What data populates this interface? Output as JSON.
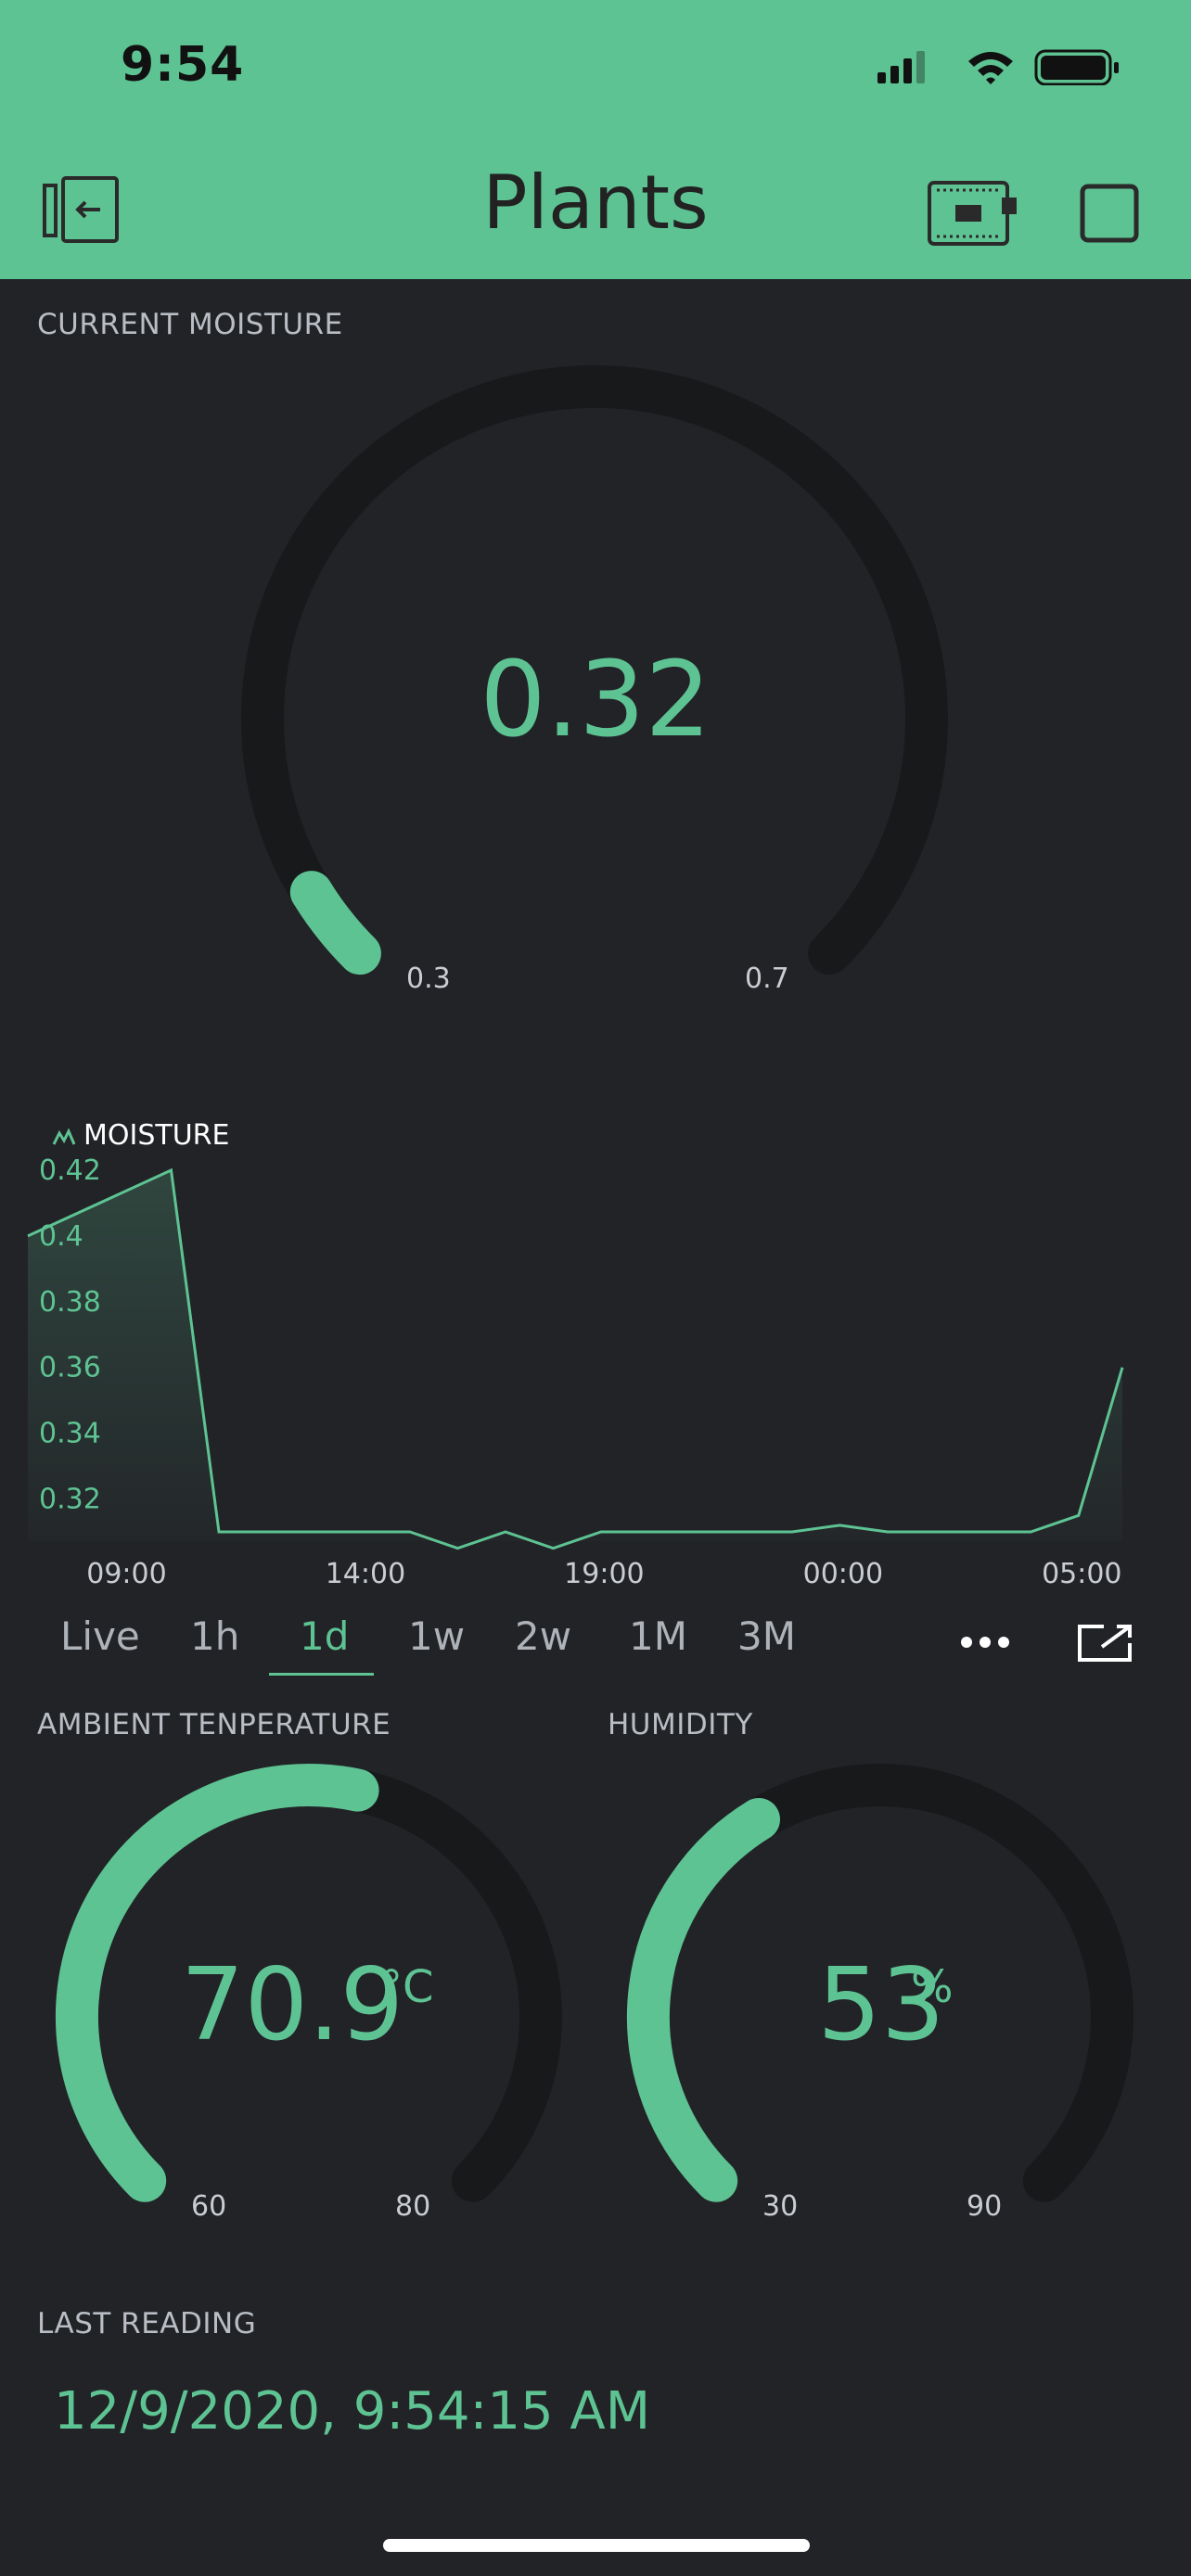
{
  "status_bar": {
    "time": "9:54",
    "icons": [
      "cellular-signal-icon",
      "wifi-icon",
      "battery-icon"
    ]
  },
  "header": {
    "title": "Plants",
    "left_icon": "exit-icon",
    "right_icons": [
      "device-board-icon",
      "square-icon"
    ],
    "background_color": "#5ec393"
  },
  "current_moisture": {
    "label": "CURRENT MOISTURE",
    "value": "0.32",
    "min": "0.3",
    "max": "0.7",
    "fraction": 0.05
  },
  "moisture_chart": {
    "legend_icon": "line-chart-icon",
    "label": "MOISTURE",
    "x_ticks": [
      "09:00",
      "14:00",
      "19:00",
      "00:00",
      "05:00"
    ],
    "y_ticks": [
      "0.42",
      "0.4",
      "0.38",
      "0.36",
      "0.34",
      "0.32"
    ]
  },
  "chart_data": {
    "type": "area",
    "series": [
      {
        "x": [
          "08:00",
          "11:00",
          "12:00",
          "13:00",
          "14:00",
          "15:00",
          "16:00",
          "17:00",
          "18:00",
          "19:00",
          "20:00",
          "21:00",
          "22:00",
          "23:00",
          "00:00",
          "01:00",
          "02:00",
          "03:00",
          "04:00",
          "05:00",
          "06:00",
          "06:55"
        ],
        "values": [
          0.4,
          0.42,
          0.31,
          0.31,
          0.31,
          0.31,
          0.31,
          0.305,
          0.31,
          0.305,
          0.31,
          0.31,
          0.31,
          0.31,
          0.31,
          0.312,
          0.31,
          0.31,
          0.31,
          0.31,
          0.315,
          0.36
        ]
      }
    ],
    "ylim": [
      0.31,
      0.42
    ],
    "color": "#5ec393",
    "grid": false
  },
  "periods": {
    "items": [
      "Live",
      "1h",
      "1d",
      "1w",
      "2w",
      "1M",
      "3M"
    ],
    "selected": "1d",
    "more_icon": "more-horizontal-icon",
    "share_icon": "share-external-icon"
  },
  "ambient_temperature": {
    "label": "AMBIENT TENPERATURE",
    "value": "70.9",
    "unit": "°C",
    "min": "60",
    "max": "80",
    "fraction": 0.545
  },
  "humidity": {
    "label": "HUMIDITY",
    "value": "53",
    "unit": "%",
    "min": "30",
    "max": "90",
    "fraction": 0.383
  },
  "last_reading": {
    "label": "LAST READING",
    "value": "12/9/2020, 9:54:15 AM"
  },
  "colors": {
    "accent": "#5ec393",
    "background": "#222327",
    "gauge_track": "#18191b"
  }
}
